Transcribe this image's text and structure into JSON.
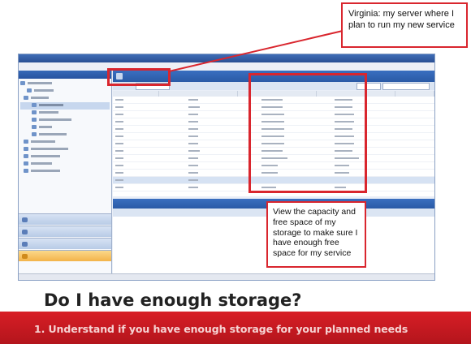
{
  "callouts": {
    "virginia": "Virginia: my server where I plan to run my new service",
    "capacity": "View the capacity and free space of my storage to make sure I have enough free space for my service"
  },
  "headline": "Do I have enough storage?",
  "banner": "1. Understand if you have enough storage for your planned needs",
  "colors": {
    "accent_red": "#d9262e",
    "banner_red": "#c81b22",
    "title_blue": "#2b5aa6"
  }
}
